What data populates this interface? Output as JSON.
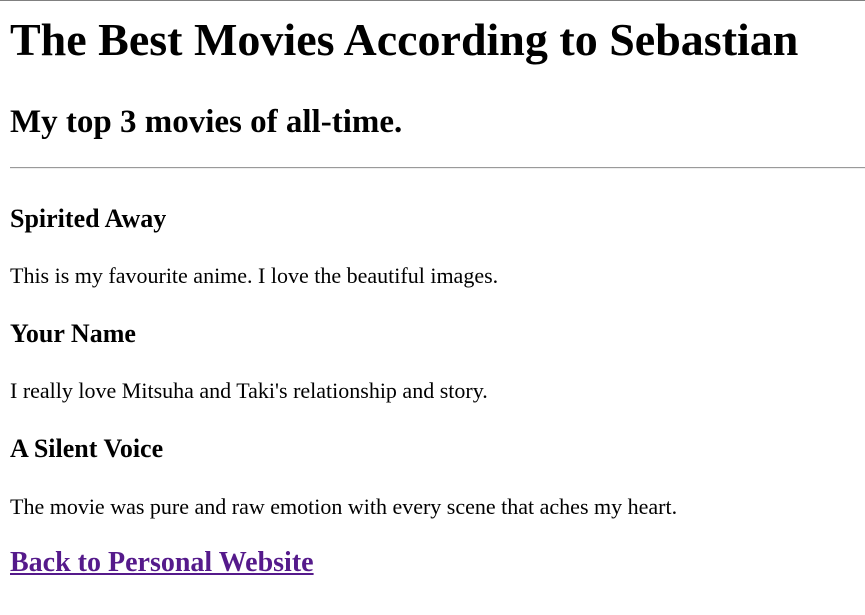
{
  "header": {
    "title": "The Best Movies According to Sebastian",
    "subtitle": "My top 3 movies of all-time."
  },
  "movies": [
    {
      "title": "Spirited Away",
      "description": "This is my favourite anime. I love the beautiful images."
    },
    {
      "title": "Your Name",
      "description": "I really love Mitsuha and Taki's relationship and story."
    },
    {
      "title": "A Silent Voice",
      "description": "The movie was pure and raw emotion with every scene that aches my heart."
    }
  ],
  "footer": {
    "back_link_label": "Back to Personal Website"
  },
  "colors": {
    "visited_link": "#551a8b",
    "text": "#000000",
    "background": "#ffffff"
  }
}
